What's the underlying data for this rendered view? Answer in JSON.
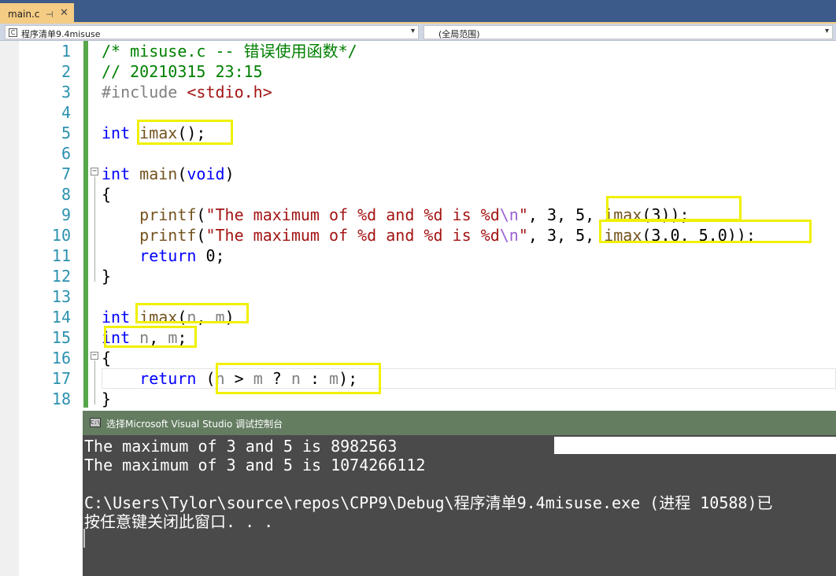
{
  "tab": {
    "title": "main.c",
    "pin": "⊣",
    "close": "✕"
  },
  "nav": {
    "project": "程序清单9.4misuse",
    "scope": "(全局范围)"
  },
  "line_numbers": [
    "1",
    "2",
    "3",
    "4",
    "5",
    "6",
    "7",
    "8",
    "9",
    "10",
    "11",
    "12",
    "13",
    "14",
    "15",
    "16",
    "17",
    "18"
  ],
  "code": {
    "l1": "/* misuse.c -- 错误使用函数*/",
    "l2": "// 20210315 23:15",
    "l3_pp": "#include ",
    "l3_inc": "<stdio.h>",
    "l5_kw": "int",
    "l5_fn": "imax",
    "l5_rest": "();",
    "l7_kw": "int",
    "l7_fn": "main",
    "l7_p1": "(",
    "l7_kw2": "void",
    "l7_p2": ")",
    "l8": "{",
    "l9_fn": "printf",
    "l9_p1": "(",
    "l9_str": "\"The maximum of %d and %d is %d",
    "l9_esc": "\\n",
    "l9_str2": "\"",
    "l9_rest": ", 3, 5, ",
    "l9_fn2": "imax",
    "l9_rest2": "(3));",
    "l10_fn": "printf",
    "l10_p1": "(",
    "l10_str": "\"The maximum of %d and %d is %d",
    "l10_esc": "\\n",
    "l10_str2": "\"",
    "l10_rest": ", 3, 5, ",
    "l10_fn2": "imax",
    "l10_rest2": "(3.0, 5.0));",
    "l11_kw": "return",
    "l11_rest": " 0;",
    "l12": "}",
    "l14_kw": "int",
    "l14_fn": "imax",
    "l14_p1": "(",
    "l14_n": "n",
    "l14_comma": ", ",
    "l14_m": "m",
    "l14_p2": ")",
    "l15_kw": "int",
    "l15_n": "n",
    "l15_comma": ", ",
    "l15_m": "m",
    "l15_semi": ";",
    "l16": "{",
    "l17_kw": "return",
    "l17_p1": " (",
    "l17_n": "n",
    "l17_gt": " > ",
    "l17_m": "m",
    "l17_q": " ? ",
    "l17_n2": "n",
    "l17_c": " : ",
    "l17_m2": "m",
    "l17_p2": ");",
    "l18": "}"
  },
  "console": {
    "title": "选择Microsoft Visual Studio 调试控制台",
    "icon": "C:\\",
    "lines": [
      "The maximum of 3 and 5 is 8982563",
      "The maximum of 3 and 5 is 1074266112",
      "",
      "C:\\Users\\Tylor\\source\\repos\\CPP9\\Debug\\程序清单9.4misuse.exe (进程 10588)已",
      "按任意键关闭此窗口. . ."
    ]
  },
  "colors": {
    "highlight": "#f0f000",
    "keyword": "#0000ff",
    "comment": "#008000",
    "string": "#a31515",
    "console_bg": "#4a4a4a",
    "console_title_bg": "#647d61"
  }
}
